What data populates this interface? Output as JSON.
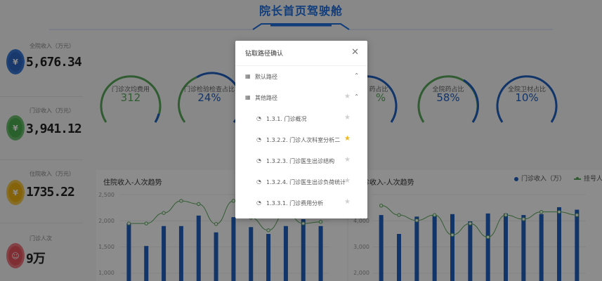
{
  "page_title": "院长首页驾驶舱",
  "colors": {
    "accent": "#1f6fe0",
    "bar": "#1f5fbf",
    "line": "#5aa85a",
    "gauge_blue": "#1f5fbf",
    "gauge_green": "#5aa85a",
    "star_active": "#f3b415"
  },
  "stats": [
    {
      "label": "全院收入（万元）",
      "value": "5,676.34",
      "icon": "money-bag-icon",
      "color": "#3a78d8"
    },
    {
      "label": "门诊收入（万元）",
      "value": "3,941.12",
      "icon": "money-bag-icon",
      "color": "#4caf50"
    },
    {
      "label": "住院收入（万元）",
      "value": "1735.22",
      "icon": "money-bag-icon",
      "color": "#f3b415"
    },
    {
      "label": "门诊人次",
      "value": "9万",
      "icon": "people-icon",
      "color": "#e8545f"
    }
  ],
  "gauges": [
    {
      "label": "门诊次均费用",
      "value": "312",
      "color": "#5aa85a",
      "fraction": 0.62
    },
    {
      "label": "门诊检验检查占比",
      "value": "24%",
      "color": "#1f5fbf",
      "fraction": 0.62
    },
    {
      "label": "药占比",
      "value": "%",
      "color": "#1f5fbf",
      "fraction": 0.62
    },
    {
      "label": "全院药占比",
      "value": "58%",
      "color": "#5aa85a",
      "fraction": 0.58
    },
    {
      "label": "全院卫材占比",
      "value": "10%",
      "color": "#1f5fbf",
      "fraction": 0.62
    }
  ],
  "charts": {
    "left": {
      "title": "住院收入-人次趋势",
      "y_ticks": [
        "2,500",
        "2,000",
        "1,500",
        "1,000"
      ]
    },
    "right": {
      "title": "门诊收入-人次趋势",
      "y_ticks": [
        "4,000",
        "3,000",
        "2,000"
      ],
      "legend_bar": "门诊收入（万）",
      "legend_line": "挂号人次"
    }
  },
  "chart_data": [
    {
      "type": "bar",
      "title": "住院收入-人次趋势",
      "ylim": [
        1000,
        2500
      ],
      "series": [
        {
          "type": "bar",
          "values": [
            1950,
            1520,
            1900,
            1900,
            2100,
            1780,
            2070,
            1880,
            1750,
            1900,
            2030,
            1900
          ]
        },
        {
          "type": "line",
          "values": [
            1950,
            1950,
            2150,
            2380,
            2320,
            1940,
            2380,
            2060,
            1820,
            2160,
            1950,
            1980
          ]
        }
      ]
    },
    {
      "type": "bar",
      "title": "门诊收入-人次趋势",
      "ylim": [
        2000,
        4500
      ],
      "series": [
        {
          "type": "bar",
          "name": "门诊收入（万）",
          "values": [
            3850,
            3250,
            3800,
            3850,
            3880,
            3650,
            3900,
            3900,
            3850,
            3880,
            4100,
            4020
          ]
        },
        {
          "type": "line",
          "name": "挂号人次",
          "values": [
            4150,
            3850,
            3680,
            3850,
            3220,
            3580,
            3150,
            3850,
            3720,
            3950,
            3950,
            3850
          ]
        }
      ]
    }
  ],
  "modal": {
    "title": "钻取路径确认",
    "close_icon": "close-icon",
    "groups": [
      {
        "label": "默认路径",
        "expanded": true
      },
      {
        "label": "其他路径",
        "expanded": true
      }
    ],
    "paths": [
      {
        "label": "1.3.1. 门诊概况",
        "starred": false
      },
      {
        "label": "1.3.2.2. 门诊人次科室分析二",
        "starred": true
      },
      {
        "label": "1.3.2.3. 门诊医生出诊结构",
        "starred": false
      },
      {
        "label": "1.3.2.4. 门诊医生出诊负荷统计",
        "starred": false
      },
      {
        "label": "1.3.3.1. 门诊费用分析",
        "starred": false
      }
    ]
  }
}
